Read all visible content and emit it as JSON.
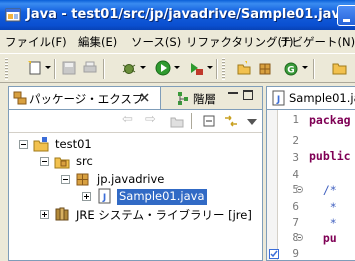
{
  "window": {
    "title": "Java - test01/src/jp/javadrive/Sample01.java - E"
  },
  "menu": [
    "ファイル(F)",
    "編集(E)",
    "ソース(S)",
    "リファクタリング(T)",
    "ナビゲート(N)"
  ],
  "left_panel": {
    "active_tab": "パッケージ・エクスプ",
    "other_tab": "階層",
    "tree": {
      "project": "test01",
      "src": "src",
      "package": "jp.javadrive",
      "file": "Sample01.java",
      "library": "JRE システム・ライブラリー [jre]"
    }
  },
  "editor": {
    "tab": "Sample01.jav",
    "line_numbers": [
      "1",
      "2",
      "3",
      "4",
      "5",
      "6",
      "7",
      "8",
      "9"
    ],
    "lines": [
      "packag",
      "",
      "public",
      "",
      "  /*",
      "   *",
      "   *",
      "  pu",
      ""
    ]
  },
  "colors": {
    "title_bar": "#0a4fd0",
    "selection": "#316ac5",
    "keyword": "#7f0055",
    "comment": "#3f5fbf"
  }
}
